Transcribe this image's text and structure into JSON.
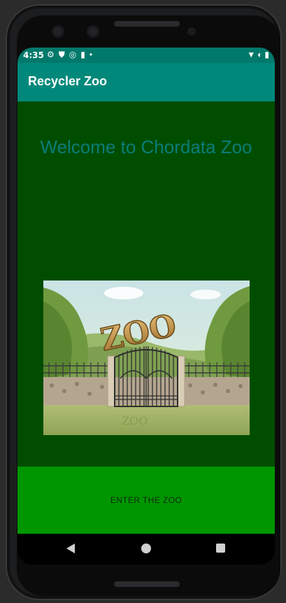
{
  "status_bar": {
    "time": "4:35",
    "icons": [
      "settings-icon",
      "shield-icon",
      "sync-icon",
      "sd-card-icon",
      "dot-icon"
    ],
    "right_icons": [
      "wifi-icon",
      "data-saver-icon",
      "battery-icon"
    ]
  },
  "app_bar": {
    "title": "Recycler Zoo"
  },
  "main": {
    "welcome_text": "Welcome to Chordata Zoo",
    "image_text": "ZOO",
    "enter_button": "ENTER THE ZOO"
  },
  "nav": {
    "back": "back-icon",
    "home": "home-icon",
    "recent": "recent-apps-icon"
  },
  "colors": {
    "status_bar": "#00796b",
    "app_bar": "#00897b",
    "content_bg": "#004d00",
    "welcome_text": "#0b7d78",
    "button_area": "#009600"
  }
}
